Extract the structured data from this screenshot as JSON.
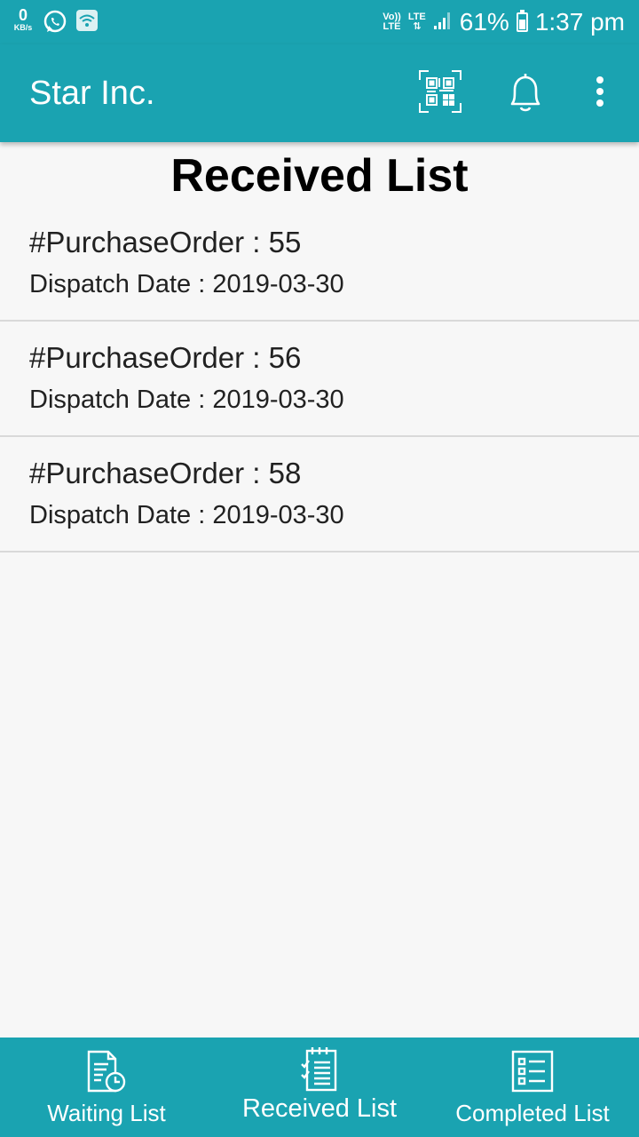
{
  "status_bar": {
    "net_speed_value": "0",
    "net_speed_unit": "KB/s",
    "volte_label_top": "Vo))",
    "volte_label_bottom": "LTE",
    "lte_label": "LTE",
    "battery_percent": "61%",
    "battery_level": 0.61,
    "time": "1:37 pm",
    "icons": [
      "whatsapp-icon",
      "wifi-hotspot-icon",
      "signal-icon",
      "battery-icon"
    ]
  },
  "app_bar": {
    "title": "Star Inc.",
    "actions": [
      "qr-code-icon",
      "notification-bell-icon",
      "overflow-menu-icon"
    ]
  },
  "page": {
    "heading": "Received List"
  },
  "orders": [
    {
      "title": "#PurchaseOrder : 55",
      "dispatch": "Dispatch Date : 2019-03-30"
    },
    {
      "title": "#PurchaseOrder : 56",
      "dispatch": "Dispatch Date : 2019-03-30"
    },
    {
      "title": "#PurchaseOrder : 58",
      "dispatch": "Dispatch Date : 2019-03-30"
    }
  ],
  "bottom_nav": {
    "active": "Received List",
    "items": [
      {
        "label": "Waiting List",
        "icon": "document-clock-icon"
      },
      {
        "label": "Received List",
        "icon": "checklist-notepad-icon"
      },
      {
        "label": "Completed List",
        "icon": "completed-checklist-icon"
      }
    ]
  },
  "colors": {
    "primary": "#1aa3b1",
    "background": "#f7f7f7",
    "divider": "#d9d9d9",
    "text": "#212121"
  }
}
